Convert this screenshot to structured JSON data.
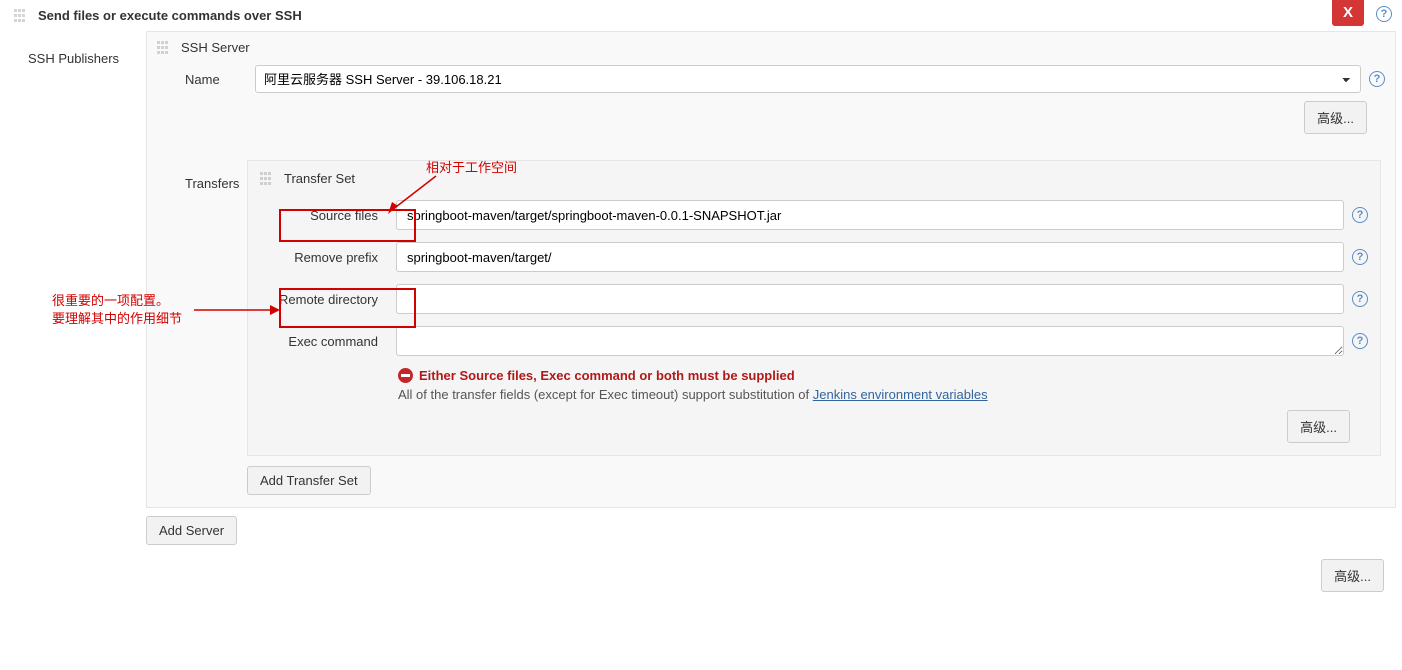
{
  "header": {
    "title": "Send files or execute commands over SSH",
    "close_label": "X"
  },
  "publishers_label": "SSH Publishers",
  "server": {
    "header": "SSH Server",
    "name_label": "Name",
    "name_value": "阿里云服务器 SSH Server - 39.106.18.21",
    "advanced_btn": "高级..."
  },
  "transfers": {
    "label": "Transfers",
    "set_header": "Transfer Set",
    "source_files_label": "Source files",
    "source_files_value": "springboot-maven/target/springboot-maven-0.0.1-SNAPSHOT.jar",
    "remove_prefix_label": "Remove prefix",
    "remove_prefix_value": "springboot-maven/target/",
    "remote_dir_label": "Remote directory",
    "remote_dir_value": "",
    "exec_cmd_label": "Exec command",
    "exec_cmd_value": "",
    "error_msg": "Either Source files, Exec command or both must be supplied",
    "hint_prefix": "All of the transfer fields (except for Exec timeout) support substitution of ",
    "hint_link": "Jenkins environment variables",
    "advanced_btn": "高级...",
    "add_transfer_btn": "Add Transfer Set"
  },
  "add_server_btn": "Add Server",
  "bottom_advanced_btn": "高级...",
  "annotations": {
    "top": "相对于工作空间",
    "left_line1": "很重要的一项配置。",
    "left_line2": "要理解其中的作用细节"
  }
}
